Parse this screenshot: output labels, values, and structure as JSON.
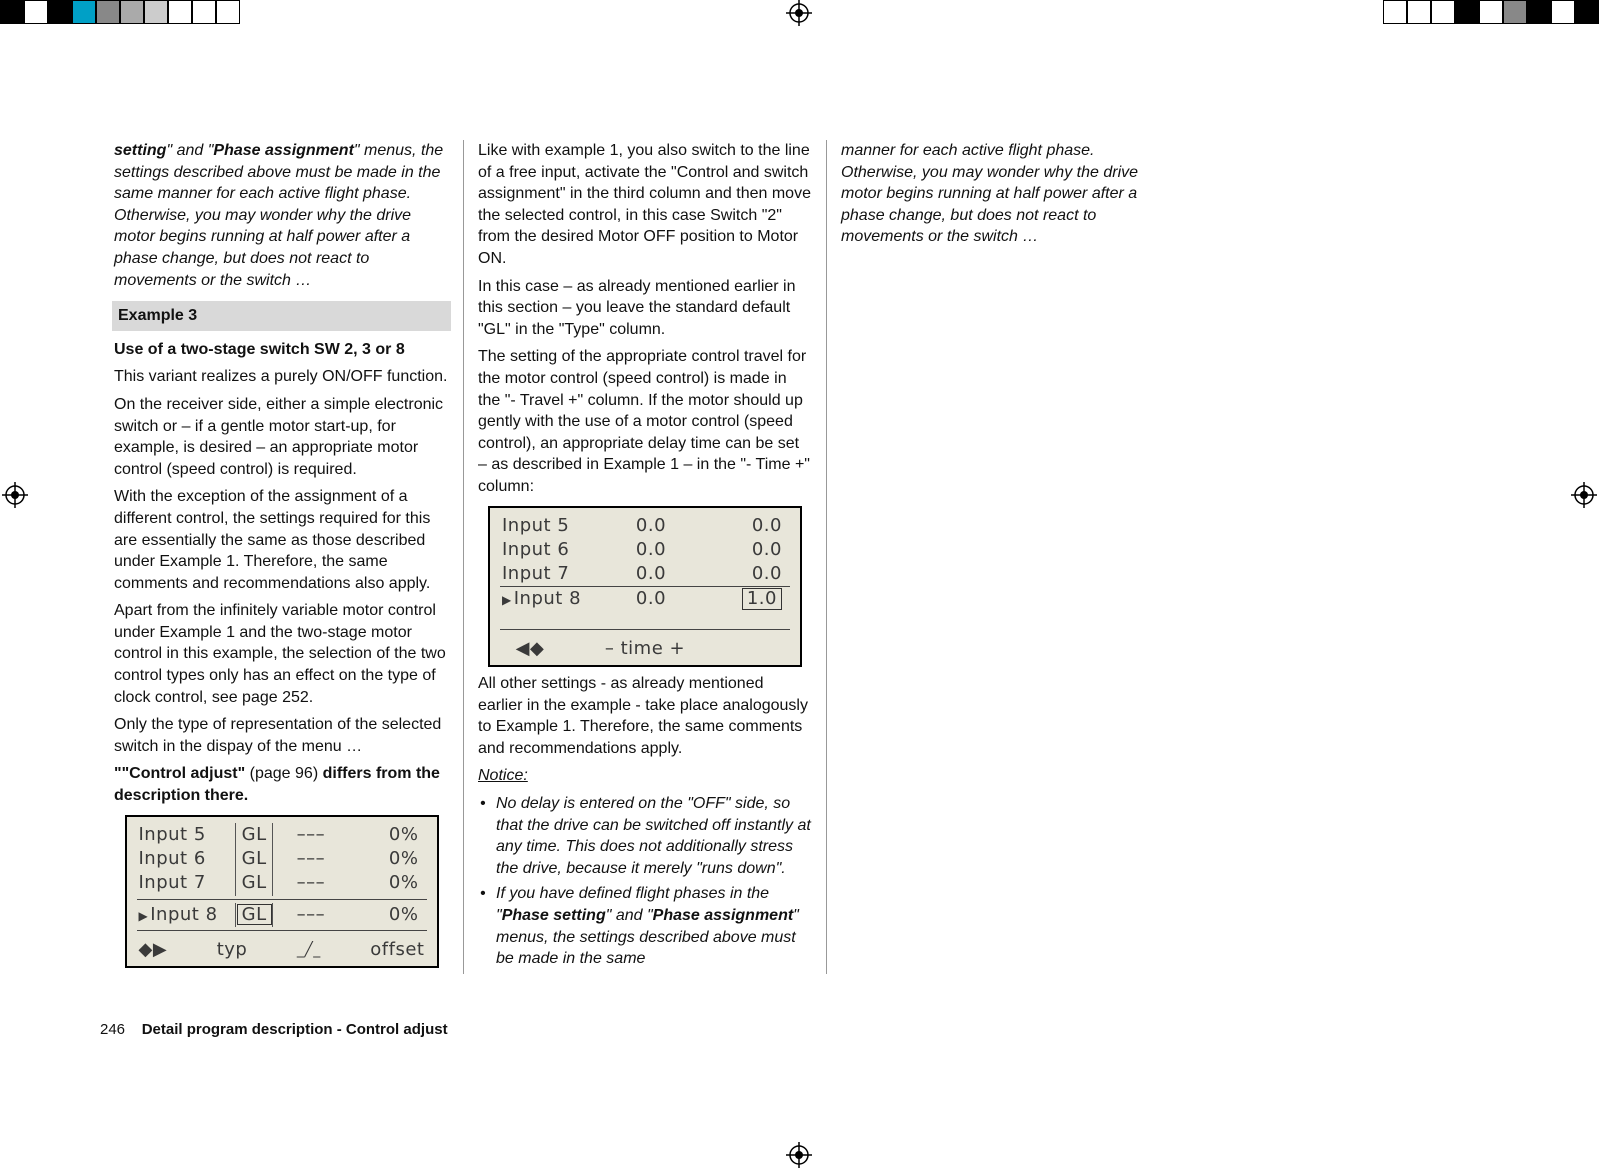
{
  "topnote": {
    "part1": "setting",
    "part2": "\" and \"",
    "part3": "Phase assignment",
    "part4": "\" menus, the settings described above must be made in the same manner for each active flight phase. Otherwise, you may wonder why the drive motor begins running at half power after a phase change, but does not react to movements or the switch …"
  },
  "ex3": {
    "heading": "Example 3",
    "sub": "Use of a two-stage switch SW 2, 3 or 8",
    "p1": "This variant realizes a purely ON/OFF function.",
    "p2": "On the receiver side, either a simple electronic switch or – if a gentle motor start-up, for example, is desired – an appropriate motor control (speed control) is required.",
    "p3": "With the exception of the assignment of a different control, the settings required for this are essentially the same as those described under Example 1. Therefore, the same comments and recommendations also apply.",
    "p4": "Apart from the infinitely variable motor control under Example 1 and the two-stage motor control in this example, the selection of the two control types only has an effect on the type of clock control, see page 252.",
    "p5": "Only the type of representation of the selected switch in the dispay of the menu …",
    "ca1": "\"",
    "ca2": "\"Control adjust\"",
    "ca3": " (page 96) ",
    "ca4": "differs from the description there."
  },
  "lcd1": {
    "r1": {
      "label": "Input  5",
      "type": "GL",
      "mid": "–––",
      "val": "0%"
    },
    "r2": {
      "label": "Input  6",
      "type": "GL",
      "mid": "–––",
      "val": "0%"
    },
    "r3": {
      "label": "Input  7",
      "type": "GL",
      "mid": "–––",
      "val": "0%"
    },
    "r4": {
      "label": "Input  8",
      "type": "GL",
      "mid": "–––",
      "val": "0%"
    },
    "f1": "typ",
    "f2": "offset"
  },
  "col2": {
    "p1": "Like with example 1, you also switch to the line of a free input, activate the \"Control and switch assignment\" in the third column and then move the selected control, in this case Switch \"2\" from the desired Motor OFF position to Motor ON.",
    "p2": "In this case – as already mentioned earlier in this section – you leave the standard default \"GL\" in the \"Type\" column.",
    "p3": "The setting of the appropriate control travel for the motor control (speed control) is made in the \"- Travel +\" column. If the motor should up gently with the use of a motor control (speed control), an appropriate delay time can be set – as described in Example 1 – in the \"- Time +\" column:",
    "p4": "All other settings - as already mentioned earlier in the example - take place analogously to Example 1. Therefore, the same comments and recommendations apply.",
    "noticeHead": "Notice:",
    "n1": "No delay is entered on the \"OFF\" side, so that the drive can be switched off instantly at any time. This does not additionally stress the drive, because it merely \"runs down\".",
    "n2a": "If you have defined flight phases in the \"",
    "n2b": "Phase setting",
    "n2c": "\" and \"",
    "n2d": "Phase assignment",
    "n2e": "\" menus, the settings described above must be made in the same"
  },
  "lcd2": {
    "r1": {
      "label": "Input  5",
      "mid": "0.0",
      "val": "0.0"
    },
    "r2": {
      "label": "Input  6",
      "mid": "0.0",
      "val": "0.0"
    },
    "r3": {
      "label": "Input  7",
      "mid": "0.0",
      "val": "0.0"
    },
    "r4": {
      "label": "Input  8",
      "mid": "0.0",
      "val": "1.0"
    },
    "foot": "– time +"
  },
  "col3": {
    "p1": "manner for each active flight phase. Otherwise, you may wonder why the drive motor begins running at half power after a phase change, but does not react to movements or the switch …"
  },
  "footer": {
    "page": "246",
    "title": "Detail program description - Control adjust"
  }
}
